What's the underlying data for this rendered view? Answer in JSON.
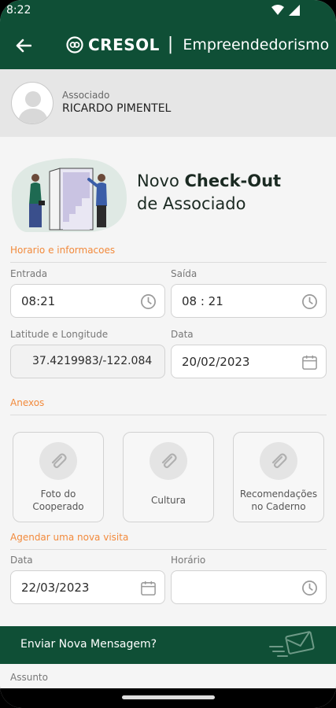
{
  "status_bar": {
    "time": "8:22"
  },
  "app_bar": {
    "brand": "CRESOL",
    "separator": "|",
    "section": "Empreendedorismo"
  },
  "associate": {
    "label": "Associado",
    "name": "RICARDO PIMENTEL"
  },
  "hero": {
    "title_line1_prefix": "Novo ",
    "title_line1_bold": "Check-Out",
    "title_line2": "de Associado"
  },
  "times": {
    "section_title": "Horario e informacoes",
    "entrada_label": "Entrada",
    "entrada_value": "08:21",
    "saida_label": "Saída",
    "saida_value": "08 : 21",
    "latlng_label": "Latitude e Longitude",
    "latlng_value": "37.4219983/-122.084",
    "data_label": "Data",
    "data_value": "20/02/2023"
  },
  "attachments": {
    "section_title": "Anexos",
    "items": [
      {
        "line1": "Foto do",
        "line2": "Cooperado"
      },
      {
        "line1": "Cultura",
        "line2": ""
      },
      {
        "line1": "Recomendações",
        "line2": "no Caderno"
      }
    ]
  },
  "schedule": {
    "section_title": "Agendar uma nova visita",
    "data_label": "Data",
    "data_value": "22/03/2023",
    "horario_label": "Horário",
    "horario_value": ""
  },
  "message_bar": {
    "label": "Enviar Nova Mensagem?"
  },
  "subject": {
    "label": "Assunto"
  },
  "colors": {
    "primary": "#0f4f36",
    "accent": "#f28a3c",
    "background": "#f5f5f5"
  }
}
